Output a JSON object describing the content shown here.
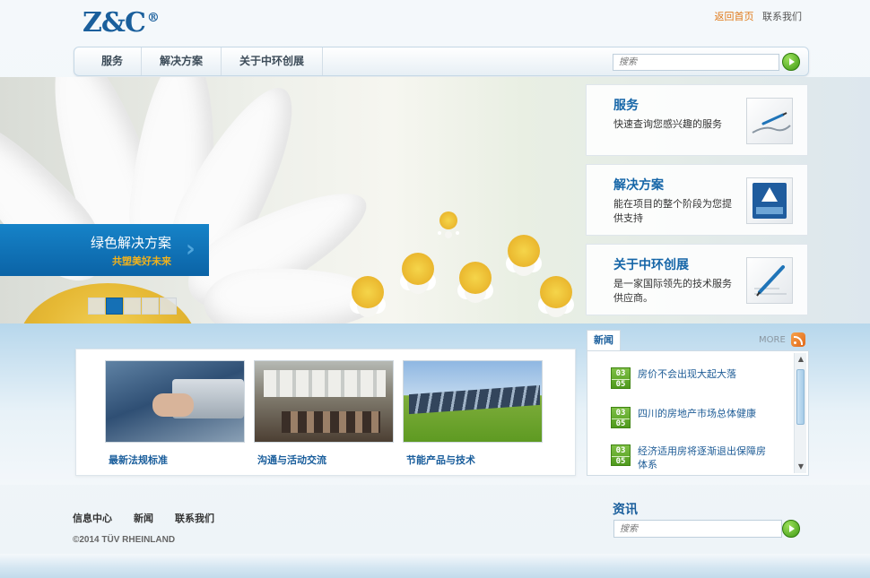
{
  "header": {
    "logo": "Z&C",
    "logo_mark": "®",
    "home_link": "返回首页",
    "contact_link": "联系我们"
  },
  "nav": {
    "items": [
      "服务",
      "解决方案",
      "关于中环创展"
    ],
    "search_placeholder": "搜索"
  },
  "hero": {
    "title": "绿色解决方案",
    "subtitle": "共塑美好未来",
    "slide_count": 5,
    "active_slide": 2
  },
  "cards": [
    {
      "title": "服务",
      "desc": "快速查询您感兴趣的服务",
      "icon": "pen-curve-icon"
    },
    {
      "title": "解决方案",
      "desc": "能在项目的整个阶段为您提供支持",
      "icon": "tuv-certified-icon"
    },
    {
      "title": "关于中环创展",
      "desc": "是一家国际领先的技术服务供应商。",
      "icon": "pen-writing-icon"
    }
  ],
  "tiles": [
    {
      "caption": "最新法规标准"
    },
    {
      "caption": "沟通与活动交流"
    },
    {
      "caption": "节能产品与技术"
    }
  ],
  "news": {
    "tab": "新闻",
    "more": "MORE",
    "items": [
      {
        "month": "03",
        "day": "05",
        "title": "房价不会出现大起大落"
      },
      {
        "month": "03",
        "day": "05",
        "title": "四川的房地产市场总体健康"
      },
      {
        "month": "03",
        "day": "05",
        "title": "经济适用房将逐渐退出保障房体系"
      }
    ]
  },
  "footer": {
    "links": [
      "信息中心",
      "新闻",
      "联系我们"
    ],
    "copyright": "©2014 TÜV RHEINLAND",
    "info_title": "资讯",
    "search_placeholder": "搜索"
  },
  "colors": {
    "brand_blue": "#1a5f9c",
    "accent_orange": "#e07a1a",
    "go_green": "#3f9a14"
  }
}
